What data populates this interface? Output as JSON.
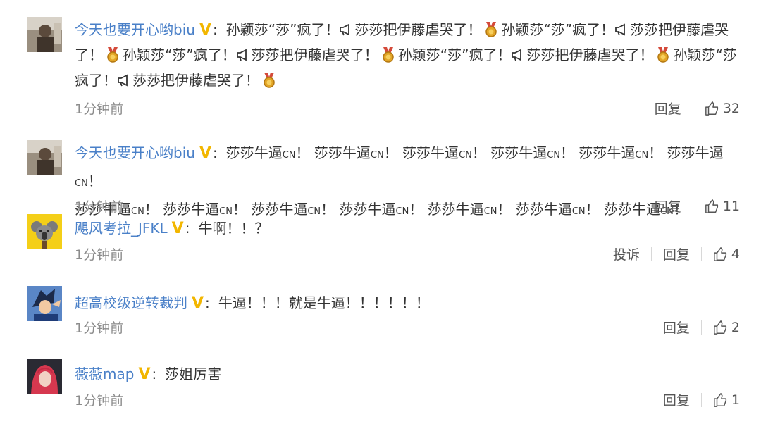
{
  "comments": [
    {
      "username": "今天也要开心哟biu",
      "verified_icon": "verified-v-icon",
      "text_parts": [
        "孙颖莎“莎”疯了！",
        "莎莎把伊藤虐哭了！",
        "孙颖莎“莎”疯了！",
        "莎莎把伊藤虐哭",
        "了！",
        "孙颖莎“莎”疯了！",
        "莎莎把伊藤虐哭了！",
        "孙颖莎“莎”疯了！",
        "莎莎把伊藤虐哭了！",
        "孙颖莎“莎",
        "疯了！",
        "莎莎把伊藤虐哭了！"
      ],
      "time": "1分钟前",
      "reply_label": "回复",
      "like_count": "32"
    },
    {
      "username": "今天也要开心哟biu",
      "verified_icon": "verified-v-icon",
      "line1": "莎莎牛逼",
      "cn": "CN",
      "time": "1分钟前",
      "reply_label": "回复",
      "like_count": "11"
    },
    {
      "username": "飓风考拉_JFKL",
      "verified_icon": "verified-v-icon",
      "text": "牛啊！！？",
      "time": "1分钟前",
      "report_label": "投诉",
      "reply_label": "回复",
      "like_count": "4"
    },
    {
      "username": "超高校级逆转裁判",
      "verified_icon": "verified-v-icon",
      "text": "牛逼！！！就是牛逼！！！！！！",
      "time": "1分钟前",
      "reply_label": "回复",
      "like_count": "2"
    },
    {
      "username": "薇薇map",
      "verified_icon": "verified-v-icon",
      "text": "莎姐厉害",
      "time": "1分钟前",
      "reply_label": "回复",
      "like_count": "1"
    }
  ],
  "icons": {
    "medal": "medal-icon",
    "horn": "megaphone-icon",
    "like": "thumbs-up-icon"
  },
  "colors": {
    "username": "#4a80c8",
    "verified": "#f2b600",
    "time": "#8c8c8c",
    "divider": "#e6e6e6"
  }
}
